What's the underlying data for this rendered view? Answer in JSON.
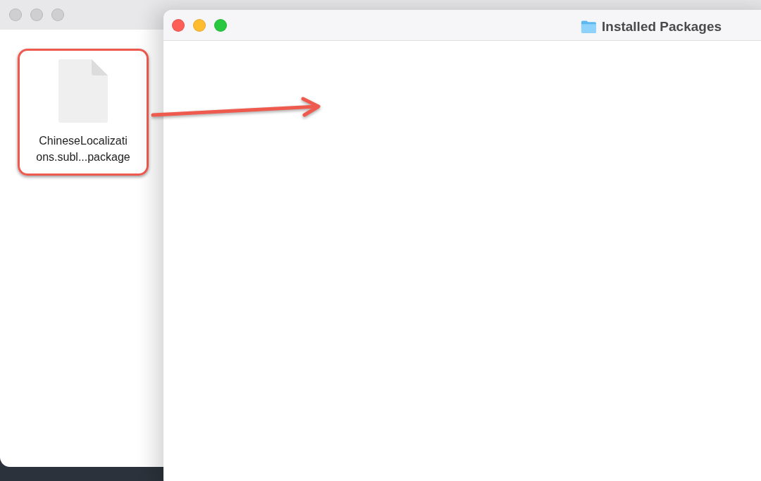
{
  "windows": [
    {
      "active": false,
      "items": [
        {
          "kind": "file",
          "label_lines": [
            "ChineseLocalizati",
            "ons.subl...package"
          ]
        }
      ]
    },
    {
      "title": "Installed Packages",
      "active": true
    }
  ]
}
